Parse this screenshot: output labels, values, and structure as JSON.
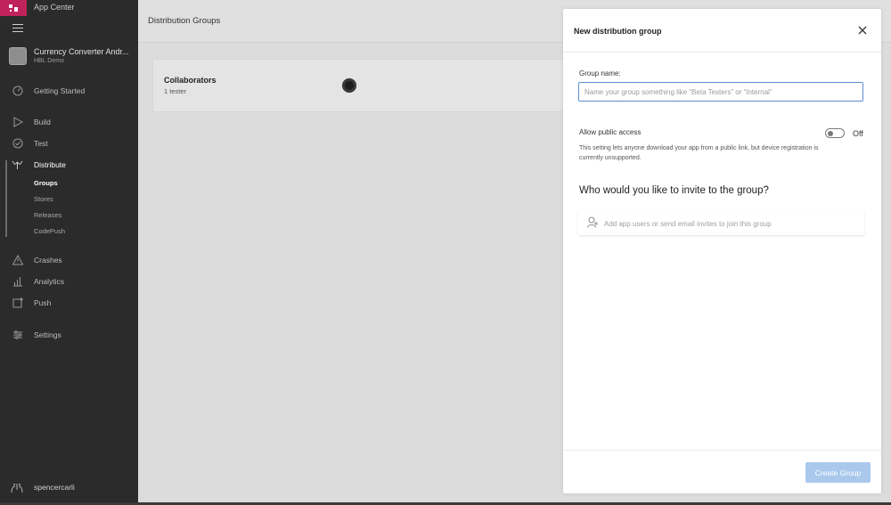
{
  "brand": {
    "logo_text": "⋯",
    "name": "App Center"
  },
  "app": {
    "title": "Currency Converter Andr...",
    "subtitle": "HBL Demo"
  },
  "nav": {
    "getting_started": "Getting Started",
    "build": "Build",
    "test": "Test",
    "distribute": "Distribute",
    "distribute_sub": [
      "Groups",
      "Stores",
      "Releases",
      "CodePush"
    ],
    "crashes": "Crashes",
    "analytics": "Analytics",
    "push": "Push",
    "settings": "Settings"
  },
  "user": {
    "name": "spencercarli"
  },
  "main": {
    "title": "Distribution Groups",
    "groups": [
      {
        "name": "Collaborators",
        "meta": "1 tester"
      }
    ]
  },
  "panel": {
    "title": "New distribution group",
    "group_name_label": "Group name:",
    "group_name_placeholder": "Name your group something like “Beta Testers” or “Internal”",
    "public_access_label": "Allow public access",
    "public_access_state": "Off",
    "public_access_desc": "This setting lets anyone download your app from a public link, but device registration is currently unsupported.",
    "invite_heading": "Who would you like to invite to the group?",
    "invite_placeholder": "Add app users or send email invites to join this group",
    "create_button": "Create Group"
  },
  "colors": {
    "accent": "#c0225b",
    "button_disabled": "#a9c8ec",
    "sidebar_bg": "#2b2b2b",
    "input_focus": "#5b8fd0"
  }
}
